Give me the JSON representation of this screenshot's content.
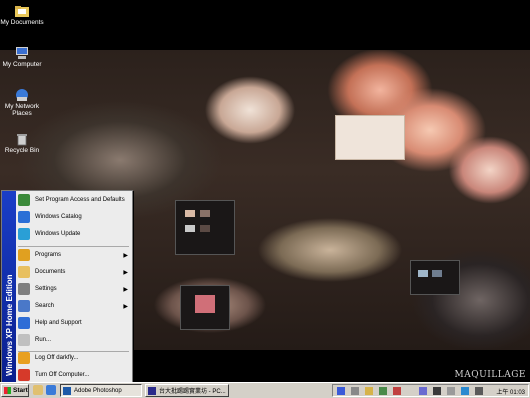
{
  "desktop": {
    "icons": [
      {
        "label": "My Documents"
      },
      {
        "label": "My Computer"
      },
      {
        "label": "My Network Places"
      },
      {
        "label": "Recycle Bin"
      }
    ],
    "watermark": "MAQUILLAGE"
  },
  "start_menu": {
    "band_text": "Windows XP Home Edition",
    "items": [
      {
        "label": "Set Program Access and Defaults",
        "icon": "program-access-icon",
        "color": "#3b8a3a"
      },
      {
        "label": "Windows Catalog",
        "icon": "windows-catalog-icon",
        "color": "#2a6fd6"
      },
      {
        "label": "Windows Update",
        "icon": "windows-update-icon",
        "color": "#2a9fd6"
      },
      {
        "label": "Programs",
        "icon": "programs-icon",
        "color": "#e0a020"
      },
      {
        "label": "Documents",
        "icon": "documents-icon",
        "color": "#e8c060"
      },
      {
        "label": "Settings",
        "icon": "settings-icon",
        "color": "#7f7f7f"
      },
      {
        "label": "Search",
        "icon": "search-icon",
        "color": "#4a78c8"
      },
      {
        "label": "Help and Support",
        "icon": "help-icon",
        "color": "#2f6dd6"
      },
      {
        "label": "Run...",
        "icon": "run-icon",
        "color": "#c0c0c0"
      },
      {
        "label": "Log Off darkfly...",
        "icon": "log-off-icon",
        "color": "#e8a020"
      },
      {
        "label": "Turn Off Computer...",
        "icon": "power-icon",
        "color": "#d63a2a"
      }
    ]
  },
  "taskbar": {
    "start_label": "Start",
    "tasks": [
      {
        "label": "Adobe Photoshop"
      },
      {
        "label": "台大批踢踢實業坊 - PC..."
      }
    ],
    "clock": "上午 01:03"
  }
}
